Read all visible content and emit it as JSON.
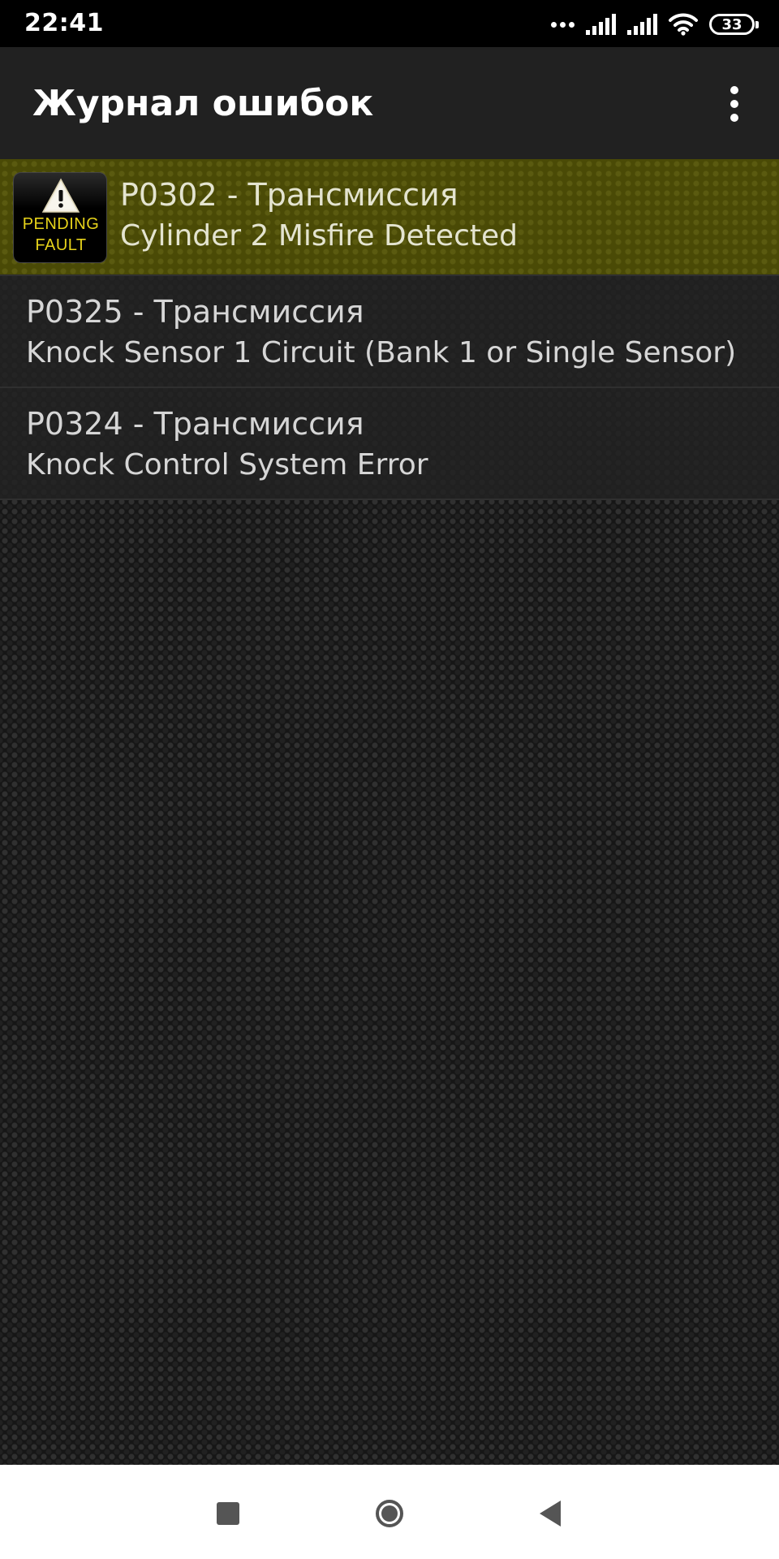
{
  "status_bar": {
    "time": "22:41",
    "battery_level": "33",
    "icons": [
      "more-dots-icon",
      "cell-signal-icon",
      "cell-signal-icon",
      "wifi-icon",
      "battery-icon"
    ]
  },
  "app_bar": {
    "title": "Журнал ошибок",
    "menu_icon": "more-vert-icon"
  },
  "faults": [
    {
      "code_line": "P0302 - Трансмиссия",
      "description": "Cylinder 2 Misfire Detected",
      "selected": true,
      "badge": {
        "line1": "PENDING",
        "line2": "FAULT",
        "icon": "warning-triangle-icon"
      }
    },
    {
      "code_line": "P0325 - Трансмиссия",
      "description": "Knock Sensor 1 Circuit (Bank 1 or Single Sensor)",
      "selected": false
    },
    {
      "code_line": "P0324 - Трансмиссия",
      "description": "Knock Control System Error",
      "selected": false
    }
  ],
  "nav_bar": {
    "icons": [
      "recents-square-icon",
      "home-circle-icon",
      "back-triangle-icon"
    ]
  },
  "colors": {
    "selected_row": "#4a4a06",
    "badge_text": "#e6d21a",
    "app_bar": "#212121"
  }
}
